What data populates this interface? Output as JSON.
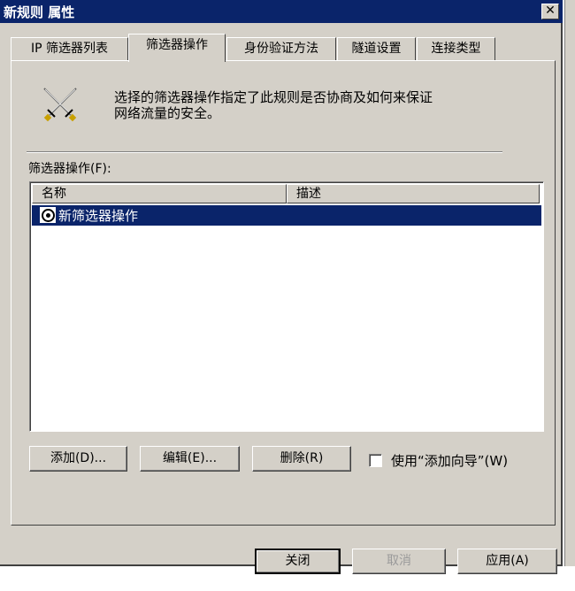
{
  "window": {
    "title": "新规则 属性",
    "close_glyph": "✕"
  },
  "tabs": [
    {
      "label": "IP 筛选器列表",
      "active": false
    },
    {
      "label": "筛选器操作",
      "active": true
    },
    {
      "label": "身份验证方法",
      "active": false
    },
    {
      "label": "隧道设置",
      "active": false
    },
    {
      "label": "连接类型",
      "active": false
    }
  ],
  "panel": {
    "icon": "crossed-swords-icon",
    "description_line1": "选择的筛选器操作指定了此规则是否协商及如何来保证",
    "description_line2": "网络流量的安全。",
    "list_label": "筛选器操作(F):",
    "columns": {
      "name": "名称",
      "description": "描述"
    },
    "rows": [
      {
        "name": "新筛选器操作",
        "description": "",
        "selected": true,
        "radio_checked": true
      }
    ],
    "buttons": {
      "add": "添加(D)...",
      "edit": "编辑(E)...",
      "remove": "删除(R)"
    },
    "wizard_checkbox": {
      "label": "使用“添加向导”(W)",
      "checked": false
    }
  },
  "footer": {
    "close": "关闭",
    "cancel": "取消",
    "apply": "应用(A)"
  },
  "colors": {
    "title_bar": "#0a246a",
    "face": "#d4d0c8",
    "selection": "#0a246a"
  }
}
